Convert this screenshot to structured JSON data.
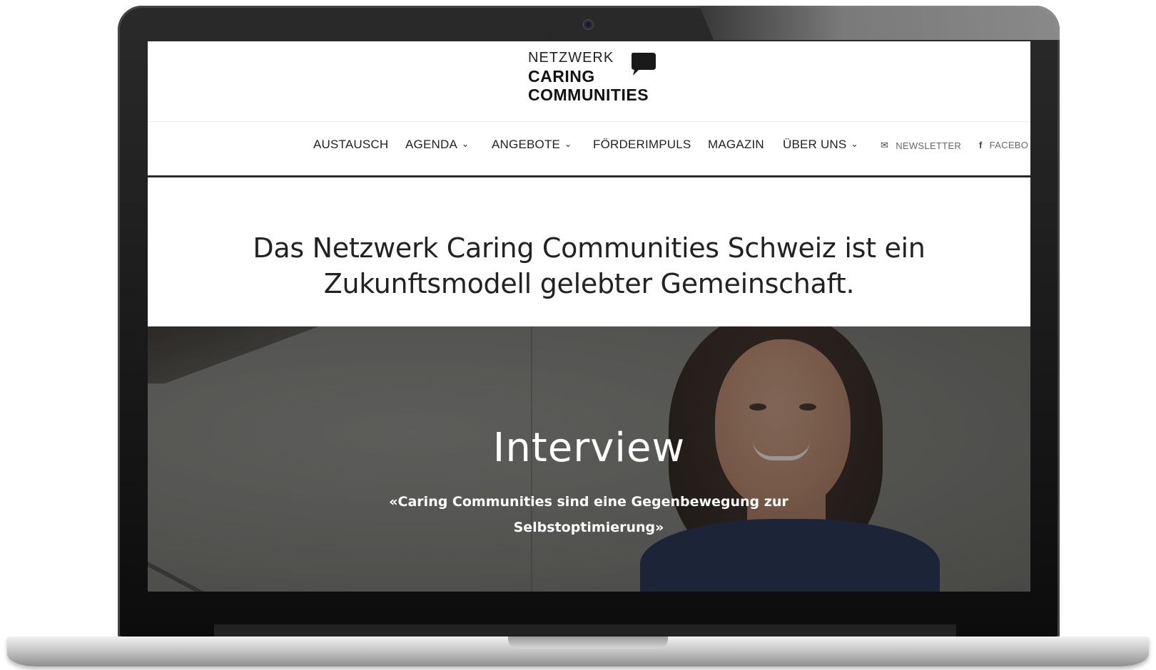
{
  "site": {
    "logo": {
      "line1": "NETZWERK",
      "line2": "CARING",
      "line3": "COMMUNITIES",
      "icon": "speech-bubble-icon"
    },
    "nav": {
      "items": [
        {
          "label": "AUSTAUSCH",
          "dropdown": false
        },
        {
          "label": "AGENDA",
          "dropdown": true
        },
        {
          "label": "ANGEBOTE",
          "dropdown": true
        },
        {
          "label": "FÖRDERIMPULS",
          "dropdown": false
        },
        {
          "label": "MAGAZIN",
          "dropdown": false
        },
        {
          "label": "ÜBER UNS",
          "dropdown": true
        }
      ],
      "newsletter": {
        "label": "NEWSLETTER",
        "icon": "envelope-icon"
      },
      "facebook": {
        "label": "FACEBO",
        "icon": "facebook-icon"
      }
    },
    "headline": {
      "line1": "Das Netzwerk Caring Communities Schweiz ist ein",
      "line2": "Zukunftsmodell gelebter Gemeinschaft."
    },
    "hero": {
      "title": "Interview",
      "quote_line1": "«Caring Communities sind eine Gegenbewegung zur",
      "quote_line2": "Selbstoptimierung»"
    }
  },
  "colors": {
    "nav_underline": "#2a2a2a",
    "text": "#222222",
    "hero_text": "#ffffff"
  }
}
